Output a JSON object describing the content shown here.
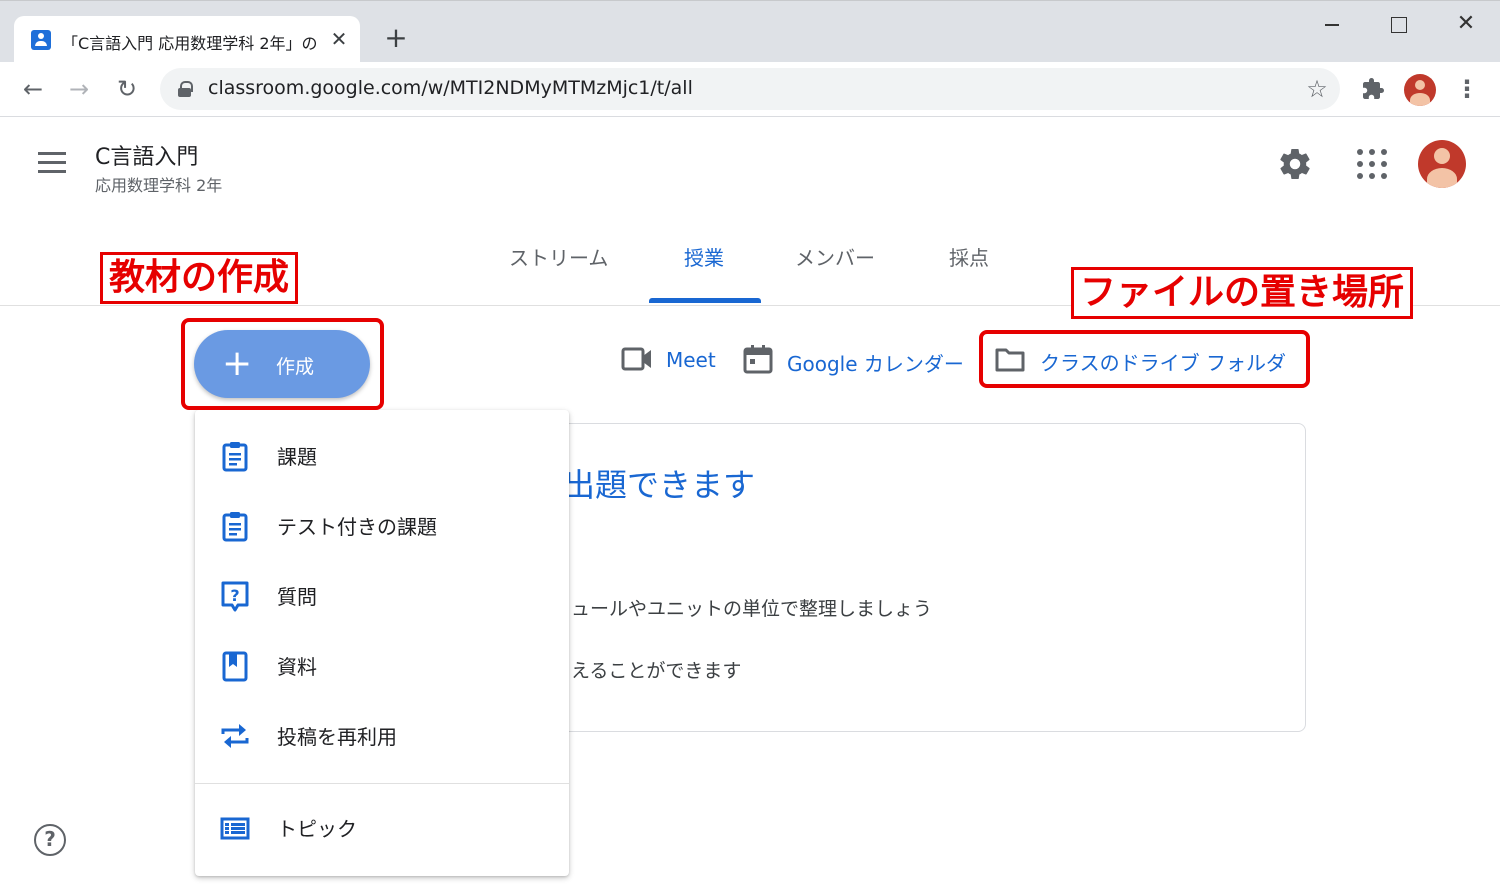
{
  "browser": {
    "tab_title": "「C言語入門 応用数理学科 2年」の",
    "tab_close": "✕",
    "new_tab": "+",
    "url": "classroom.google.com/w/MTI2NDMyMTMzMjc1/t/all"
  },
  "classroom": {
    "class_name": "C言語入門",
    "class_section": "応用数理学科 2年",
    "tabs": [
      {
        "label": "ストリーム"
      },
      {
        "label": "授業"
      },
      {
        "label": "メンバー"
      },
      {
        "label": "採点"
      }
    ],
    "active_tab": "授業"
  },
  "create_button": {
    "label": "作成",
    "icon": "plus-icon"
  },
  "links": {
    "meet": "Meet",
    "calendar": "Google カレンダー",
    "drive_folder": "クラスのドライブ フォルダ"
  },
  "empty_state": {
    "title": "出題できます",
    "line1": "ュールやユニットの単位で整理しましょう",
    "line2": "えることができます"
  },
  "create_menu": {
    "items": [
      {
        "label": "課題",
        "icon": "assignment-icon"
      },
      {
        "label": "テスト付きの課題",
        "icon": "quiz-assignment-icon"
      },
      {
        "label": "質問",
        "icon": "question-icon"
      },
      {
        "label": "資料",
        "icon": "material-icon"
      },
      {
        "label": "投稿を再利用",
        "icon": "reuse-post-icon"
      }
    ],
    "topic": {
      "label": "トピック",
      "icon": "topic-icon"
    }
  },
  "annotations": {
    "create_materials": "教材の作成",
    "file_location": "ファイルの置き場所"
  },
  "colors": {
    "accent_blue": "#1967d2",
    "create_button": "#6a9ae3",
    "annotation_red": "#e60000",
    "avatar": "#c0392b"
  }
}
